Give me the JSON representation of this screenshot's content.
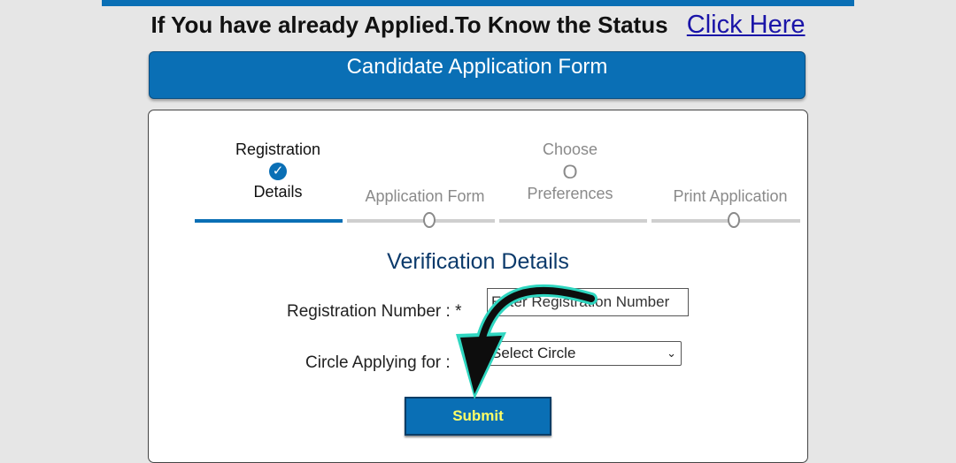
{
  "status_line": {
    "text": "If You have already Applied.To Know the Status",
    "link": "Click Here"
  },
  "form_header": {
    "title": "Candidate Application Form"
  },
  "steps": [
    {
      "label_top": "Registration",
      "label_bottom": "Details",
      "state": "done"
    },
    {
      "label_top": "",
      "label_bottom": "Application Form",
      "state": "pending"
    },
    {
      "label_top": "Choose",
      "label_bottom": "Preferences",
      "state": "pending"
    },
    {
      "label_top": "",
      "label_bottom": "Print Application",
      "state": "pending"
    }
  ],
  "section_title": "Verification Details",
  "fields": {
    "registration_label": "Registration Number : *",
    "registration_placeholder": "Enter Registration Number",
    "circle_label": "Circle Applying for :",
    "circle_selected": "Select Circle"
  },
  "submit_label": "Submit",
  "colors": {
    "primary_blue": "#0a6fb5",
    "submit_text": "#ffff66",
    "link": "#1a14a8",
    "section_title": "#0b3a6b",
    "arrow_glow": "#2fd6c0"
  },
  "icons": {
    "check": "check-circle-icon",
    "step_pending": "empty-circle-icon",
    "dropdown": "chevron-down-icon",
    "overlay": "curved-arrow-icon"
  }
}
